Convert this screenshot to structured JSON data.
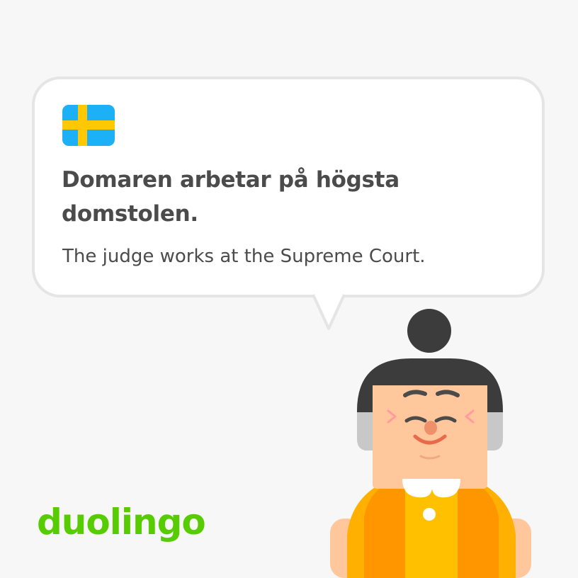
{
  "card": {
    "language_flag": "sweden-flag",
    "sentence": "Domaren arbetar på högsta domstolen.",
    "translation": "The judge works at the Supreme Court."
  },
  "brand": {
    "logo_text": "duolingo"
  },
  "character": {
    "name": "judge-character"
  },
  "colors": {
    "background": "#f7f7f7",
    "bubble": "#ffffff",
    "bubble_border": "#e5e5e5",
    "text": "#4b4b4b",
    "brand_green": "#58cc02",
    "flag_blue": "#1cb0f6",
    "flag_yellow": "#ffc800"
  }
}
